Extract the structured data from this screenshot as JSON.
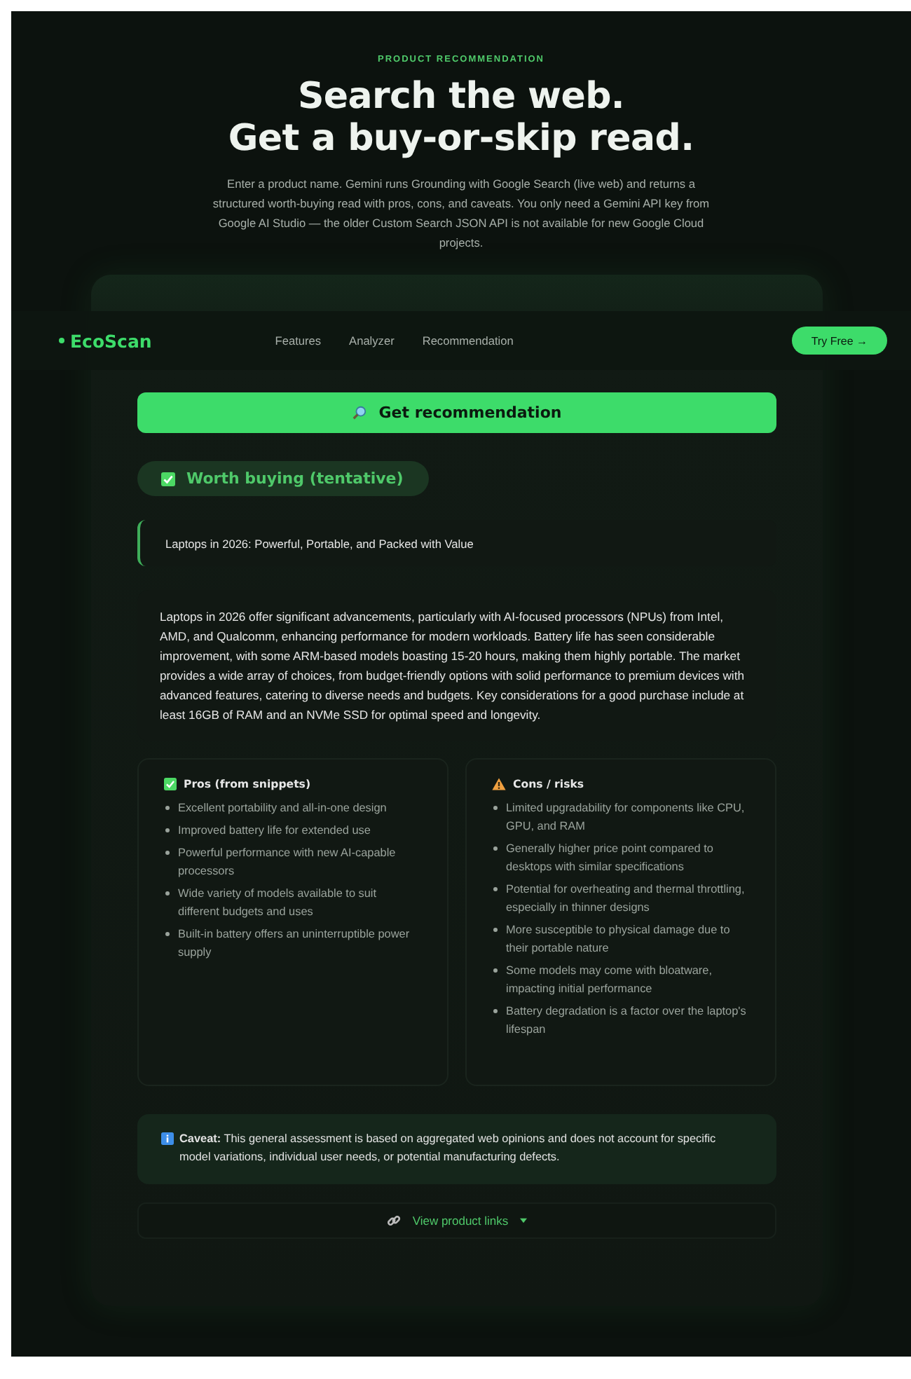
{
  "eyebrow": "PRODUCT RECOMMENDATION",
  "headline": [
    "Search the web.",
    "Get a buy-or-skip read."
  ],
  "intro": "Enter a product name. Gemini runs Grounding with Google Search (live web) and returns a structured worth-buying read with pros, cons, and caveats. You only need a Gemini API key from Google AI Studio — the older Custom Search JSON API is not available for new Google Cloud projects.",
  "nav": {
    "logo": "EcoScan",
    "links": [
      "Features",
      "Analyzer",
      "Recommendation"
    ],
    "cta": "Try Free →"
  },
  "action": {
    "label": "Get recommendation"
  },
  "verdict": {
    "label": "Worth buying (tentative)",
    "kind": "buy"
  },
  "title": "Laptops in 2026: Powerful, Portable, and Packed with Value",
  "summary": "Laptops in 2026 offer significant advancements, particularly with AI-focused processors (NPUs) from Intel, AMD, and Qualcomm, enhancing performance for modern workloads. Battery life has seen considerable improvement, with some ARM-based models boasting 15-20 hours, making them highly portable. The market provides a wide array of choices, from budget-friendly options with solid performance to premium devices with advanced features, catering to diverse needs and budgets. Key considerations for a good purchase include at least 16GB of RAM and an NVMe SSD for optimal speed and longevity.",
  "columns": [
    {
      "kind": "pros",
      "heading": "Pros (from snippets)",
      "items": [
        "Excellent portability and all-in-one design",
        "Improved battery life for extended use",
        "Powerful performance with new AI-capable processors",
        "Wide variety of models available to suit different budgets and uses",
        "Built-in battery offers an uninterruptible power supply"
      ]
    },
    {
      "kind": "cons",
      "heading": "Cons / risks",
      "items": [
        "Limited upgradability for components like CPU, GPU, and RAM",
        "Generally higher price point compared to desktops with similar specifications",
        "Potential for overheating and thermal throttling, especially in thinner designs",
        "More susceptible to physical damage due to their portable nature",
        "Some models may come with bloatware, impacting initial performance",
        "Battery degradation is a factor over the laptop's lifespan"
      ]
    }
  ],
  "caveat": "**Caveat:** This general assessment is based on aggregated web opinions and does not account for specific model variations, individual user needs, or potential manufacturing defects.",
  "links": {
    "label": "View product links",
    "expanded": false
  }
}
